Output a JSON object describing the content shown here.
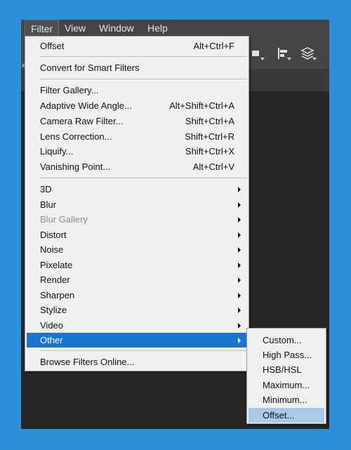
{
  "menubar": {
    "items": [
      {
        "label": "Filter"
      },
      {
        "label": "View"
      },
      {
        "label": "Window"
      },
      {
        "label": "Help"
      }
    ]
  },
  "filter_menu": {
    "sections": [
      [
        {
          "label": "Offset",
          "shortcut": "Alt+Ctrl+F"
        }
      ],
      [
        {
          "label": "Convert for Smart Filters",
          "shortcut": ""
        }
      ],
      [
        {
          "label": "Filter Gallery...",
          "shortcut": ""
        },
        {
          "label": "Adaptive Wide Angle...",
          "shortcut": "Alt+Shift+Ctrl+A"
        },
        {
          "label": "Camera Raw Filter...",
          "shortcut": "Shift+Ctrl+A"
        },
        {
          "label": "Lens Correction...",
          "shortcut": "Shift+Ctrl+R"
        },
        {
          "label": "Liquify...",
          "shortcut": "Shift+Ctrl+X"
        },
        {
          "label": "Vanishing Point...",
          "shortcut": "Alt+Ctrl+V"
        }
      ],
      [
        {
          "label": "3D",
          "submenu": true
        },
        {
          "label": "Blur",
          "submenu": true
        },
        {
          "label": "Blur Gallery",
          "submenu": true,
          "disabled": true
        },
        {
          "label": "Distort",
          "submenu": true
        },
        {
          "label": "Noise",
          "submenu": true
        },
        {
          "label": "Pixelate",
          "submenu": true
        },
        {
          "label": "Render",
          "submenu": true
        },
        {
          "label": "Sharpen",
          "submenu": true
        },
        {
          "label": "Stylize",
          "submenu": true
        },
        {
          "label": "Video",
          "submenu": true
        },
        {
          "label": "Other",
          "submenu": true,
          "highlighted": true
        }
      ],
      [
        {
          "label": "Browse Filters Online...",
          "shortcut": ""
        }
      ]
    ]
  },
  "other_submenu": {
    "items": [
      {
        "label": "Custom..."
      },
      {
        "label": "High Pass..."
      },
      {
        "label": "HSB/HSL"
      },
      {
        "label": "Maximum..."
      },
      {
        "label": "Minimum..."
      },
      {
        "label": "Offset...",
        "hovered": true
      }
    ]
  },
  "toolbar_fragment": {
    "left_label": "x"
  },
  "colors": {
    "background": "#2e8fd9",
    "menubar": "#454545",
    "menu_highlight": "#1a73d1",
    "submenu_hover": "#a9cbe8"
  }
}
